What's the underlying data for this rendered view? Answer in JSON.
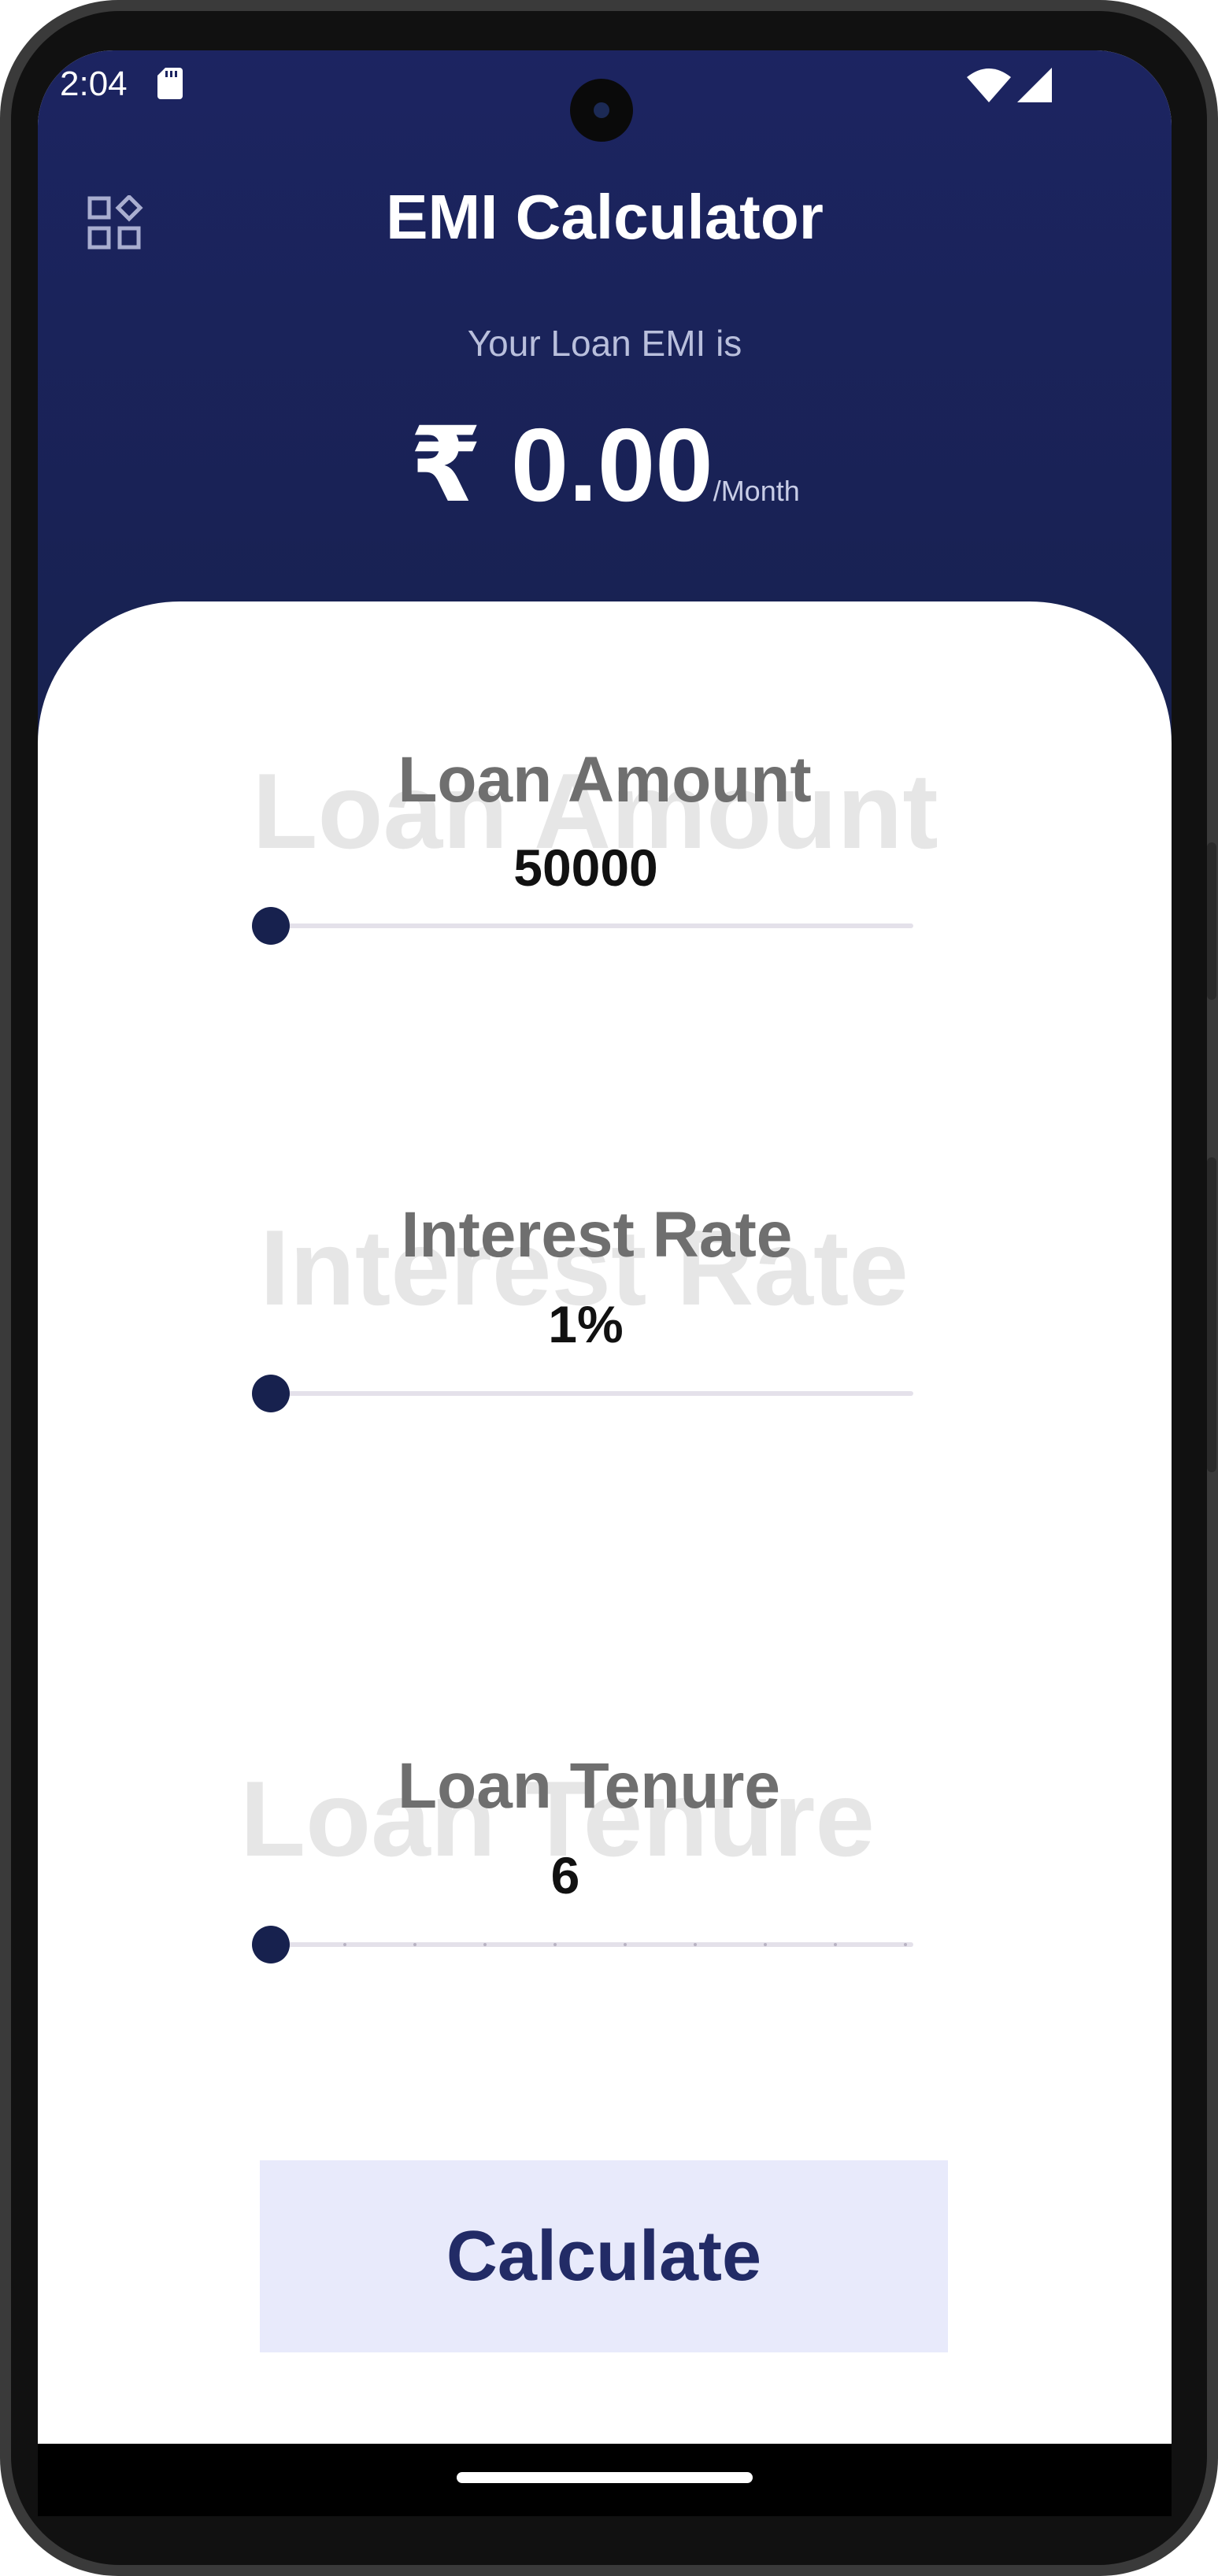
{
  "status_bar": {
    "time": "2:04",
    "icons": [
      "sd-card-icon",
      "wifi-icon",
      "signal-icon"
    ]
  },
  "header": {
    "menu_icon": "apps-grid-icon",
    "title": "EMI Calculator",
    "emi_label": "Your Loan EMI is",
    "emi_amount": "₹ 0.00",
    "emi_unit": "/Month"
  },
  "sections": {
    "loan_amount": {
      "title": "Loan Amount",
      "ghost": "Loan Amount",
      "value": "50000",
      "slider_fraction": 0
    },
    "interest_rate": {
      "title": "Interest Rate",
      "ghost": "Interest Rate",
      "value": "1%",
      "slider_fraction": 0
    },
    "loan_tenure": {
      "title": "Loan Tenure",
      "ghost": "Loan Tenure",
      "value": "6",
      "slider_fraction": 0
    }
  },
  "actions": {
    "calculate_label": "Calculate"
  },
  "colors": {
    "header_bg": "#1c2461",
    "accent": "#17214e",
    "button_bg": "#e8eafb",
    "button_text": "#222b66"
  }
}
